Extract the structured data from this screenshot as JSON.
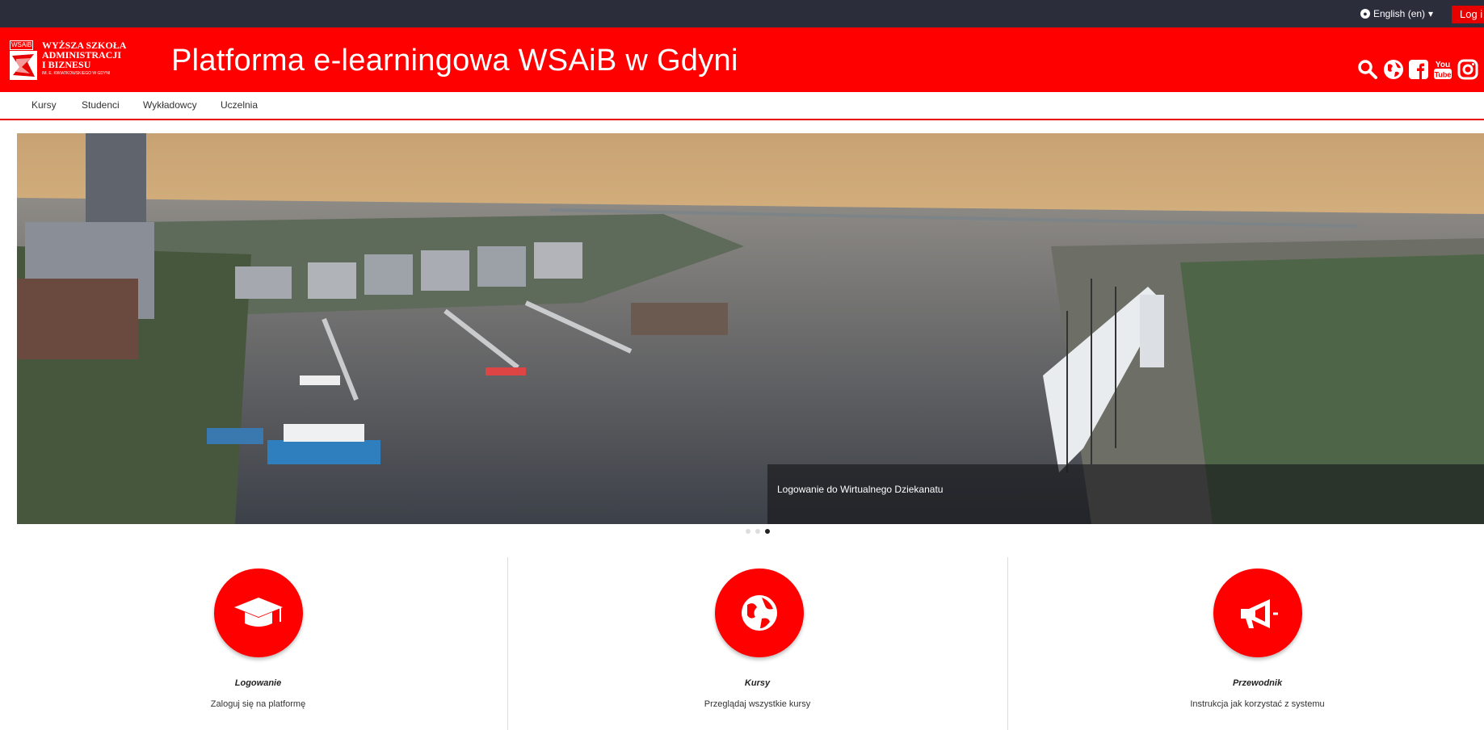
{
  "topbar": {
    "language": "English (en)",
    "login": "Log i"
  },
  "header": {
    "logo_badge": "WSAiB",
    "logo_line1": "WYŻSZA SZKOŁA",
    "logo_line2": "ADMINISTRACJI",
    "logo_line3": "I BIZNESU",
    "logo_line4": "IM. E. KWIATKOWSKIEGO W GDYNI",
    "title": "Platforma e-learningowa WSAiB w Gdyni",
    "icons": [
      "search-icon",
      "globe-icon",
      "facebook-icon",
      "youtube-icon",
      "instagram-icon"
    ]
  },
  "nav": [
    "Kursy",
    "Studenci",
    "Wykładowcy",
    "Uczelnia"
  ],
  "carousel": {
    "caption": "Logowanie do Wirtualnego Dziekanatu",
    "slides": 3,
    "active": 3
  },
  "features": [
    {
      "title": "Logowanie",
      "desc": "Zaloguj się na platformę",
      "icon": "graduation-cap-icon"
    },
    {
      "title": "Kursy",
      "desc": "Przeglądaj wszystkie kursy",
      "icon": "globe-icon"
    },
    {
      "title": "Przewodnik",
      "desc": "Instrukcja jak korzystać z systemu",
      "icon": "megaphone-icon"
    }
  ],
  "colors": {
    "brand": "#ff0000",
    "topbar": "#2b2d3b"
  }
}
